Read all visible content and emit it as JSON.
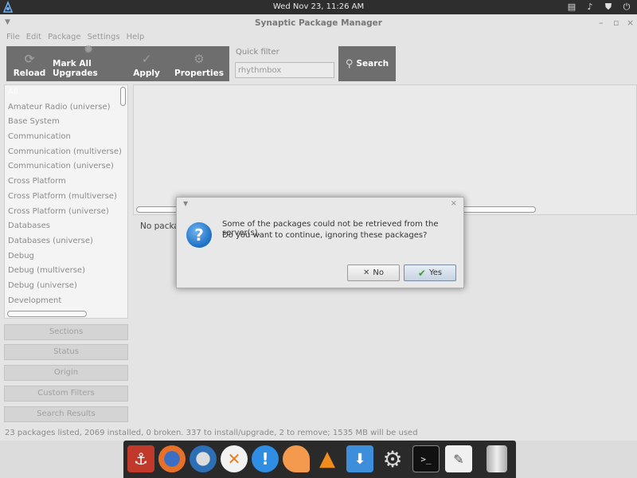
{
  "top_panel": {
    "clock": "Wed Nov 23, 11:26 AM",
    "tray_icons": [
      "network-icon",
      "volume-icon",
      "shield-icon",
      "power-icon"
    ]
  },
  "window": {
    "title": "Synaptic Package Manager",
    "menu": [
      "File",
      "Edit",
      "Package",
      "Settings",
      "Help"
    ],
    "toolbar": {
      "reload": "Reload",
      "mark_all_upgrades": "Mark All Upgrades",
      "apply": "Apply",
      "properties": "Properties",
      "quick_filter_label": "Quick filter",
      "quick_filter_value": "rhythmbox",
      "search": "Search"
    },
    "categories": [
      "All",
      "Amateur Radio (universe)",
      "Base System",
      "Communication",
      "Communication (multiverse)",
      "Communication (universe)",
      "Cross Platform",
      "Cross Platform (multiverse)",
      "Cross Platform (universe)",
      "Databases",
      "Databases (universe)",
      "Debug",
      "Debug (multiverse)",
      "Debug (universe)",
      "Development"
    ],
    "filter_buttons": [
      "Sections",
      "Status",
      "Origin",
      "Custom Filters",
      "Search Results"
    ],
    "details_text": "No packa",
    "status_text": "23 packages listed, 2069 installed, 0 broken. 337 to install/upgrade, 2 to remove; 1535 MB will be used"
  },
  "dialog": {
    "line1": "Some of the packages could not be retrieved from the server(s).",
    "line2": "Do you want to continue, ignoring these packages?",
    "no": "No",
    "yes": "Yes"
  },
  "dock": {
    "icons": [
      "anchor-icon",
      "firefox-icon",
      "thunderbird-icon",
      "close-app-icon",
      "notification-icon",
      "slice-icon",
      "vlc-icon",
      "download-icon",
      "settings-gear-icon",
      "terminal-icon",
      "text-editor-icon",
      "trash-icon"
    ]
  }
}
